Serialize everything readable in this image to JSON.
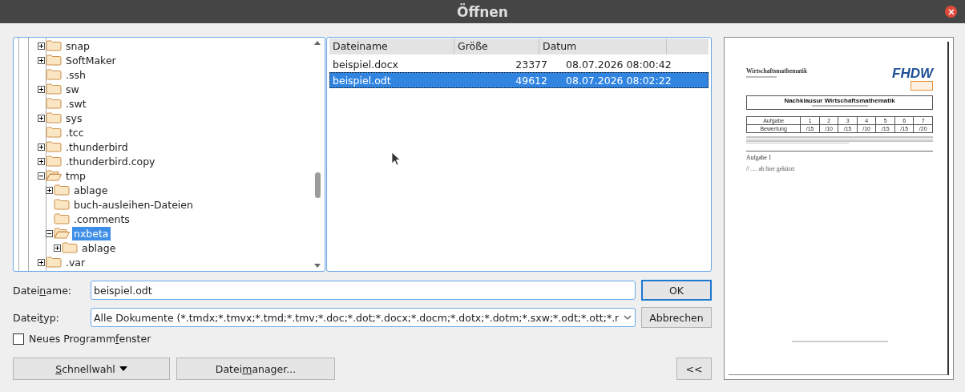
{
  "window": {
    "title": "Öffnen"
  },
  "tree": [
    {
      "name": "snap",
      "has_children": true,
      "expanded": false,
      "selected": false
    },
    {
      "name": "SoftMaker",
      "has_children": true,
      "expanded": false,
      "selected": false
    },
    {
      "name": ".ssh",
      "has_children": false,
      "expanded": false,
      "selected": false
    },
    {
      "name": "sw",
      "has_children": true,
      "expanded": false,
      "selected": false
    },
    {
      "name": ".swt",
      "has_children": false,
      "expanded": false,
      "selected": false
    },
    {
      "name": "sys",
      "has_children": true,
      "expanded": false,
      "selected": false
    },
    {
      "name": ".tcc",
      "has_children": false,
      "expanded": false,
      "selected": false
    },
    {
      "name": ".thunderbird",
      "has_children": true,
      "expanded": false,
      "selected": false
    },
    {
      "name": ".thunderbird.copy",
      "has_children": true,
      "expanded": false,
      "selected": false
    },
    {
      "name": "tmp",
      "has_children": true,
      "expanded": true,
      "selected": false,
      "children": [
        {
          "name": "ablage",
          "has_children": true,
          "expanded": false,
          "selected": false
        },
        {
          "name": "buch-ausleihen-Dateien",
          "has_children": false,
          "expanded": false,
          "selected": false
        },
        {
          "name": ".comments",
          "has_children": false,
          "expanded": false,
          "selected": false
        },
        {
          "name": "nxbeta",
          "has_children": true,
          "expanded": true,
          "selected": true,
          "children": [
            {
              "name": "ablage",
              "has_children": true,
              "expanded": false,
              "selected": false
            }
          ]
        }
      ]
    },
    {
      "name": ".var",
      "has_children": true,
      "expanded": false,
      "selected": false
    }
  ],
  "file_list": {
    "columns": [
      "Dateiname",
      "Größe",
      "Datum"
    ],
    "rows": [
      {
        "name": "beispiel.docx",
        "size": "23377",
        "date": "08.07.2026 08:00:42",
        "selected": false
      },
      {
        "name": "beispiel.odt",
        "size": "49612",
        "date": "08.07.2026 08:02:22",
        "selected": true
      }
    ]
  },
  "preview": {
    "heading": "Wirtschaftsmathematik",
    "logo": "FHDW",
    "title": "Nachklausur Wirtschaftsmathematik",
    "score_table": {
      "header": [
        "Aufgabe",
        "1",
        "2",
        "3",
        "4",
        "5",
        "6",
        "7"
      ],
      "row": [
        "Bewertung",
        "/15",
        "/10",
        "/15",
        "/10",
        "/15",
        "/15",
        "/20"
      ]
    },
    "section": "Aufgabe 1",
    "note": "// .... ab hier gekürzt"
  },
  "filename": {
    "label_parts": [
      "Datei",
      "n",
      "ame:"
    ],
    "value": "beispiel.odt"
  },
  "filetype": {
    "label_parts": [
      "Datei",
      "t",
      "yp:"
    ],
    "value": "Alle Dokumente (*.tmdx;*.tmvx;*.tmd;*.tmv;*.doc;*.dot;*.docx;*.docm;*.dotx;*.dotm;*.sxw;*.odt;*.ott;*.r"
  },
  "new_window": {
    "label_parts": [
      "Neues Programm",
      "f",
      "enster"
    ],
    "checked": false
  },
  "buttons": {
    "ok": "OK",
    "cancel": "Abbrechen",
    "quick": {
      "accel": "S",
      "after": "chnellwahl"
    },
    "manager": [
      "Datei",
      "m",
      "anager..."
    ],
    "collapse": "<<"
  }
}
